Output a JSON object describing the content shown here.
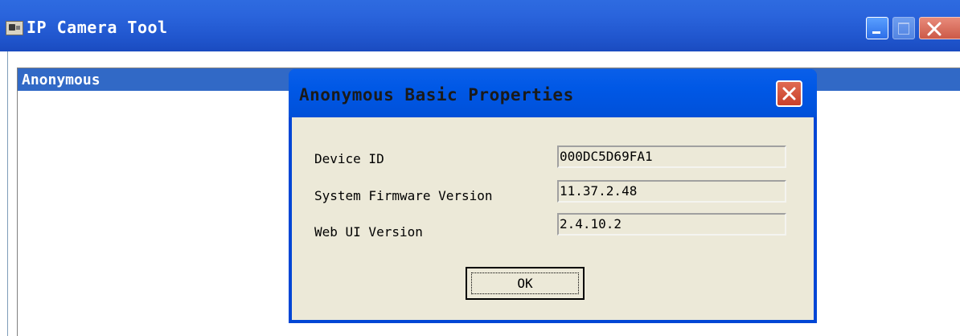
{
  "window": {
    "title": "IP Camera Tool",
    "app_icon": "camera-tool-icon",
    "controls": [
      "minimize-icon",
      "maximize-icon",
      "close-icon"
    ]
  },
  "device_list": {
    "selected_device": "Anonymous"
  },
  "dialog": {
    "title": "Anonymous Basic Properties",
    "properties": [
      {
        "label": "Device ID",
        "value": "000DC5D69FA1"
      },
      {
        "label": "System Firmware Version",
        "value": "11.37.2.48"
      },
      {
        "label": "Web UI Version",
        "value": "2.4.10.2"
      }
    ],
    "ok_label": "OK"
  },
  "colors": {
    "titlebar_blue": "#2a64dc",
    "selection_blue": "#3169c6",
    "dialog_face": "#ece9d8",
    "close_red": "#c9402a"
  }
}
